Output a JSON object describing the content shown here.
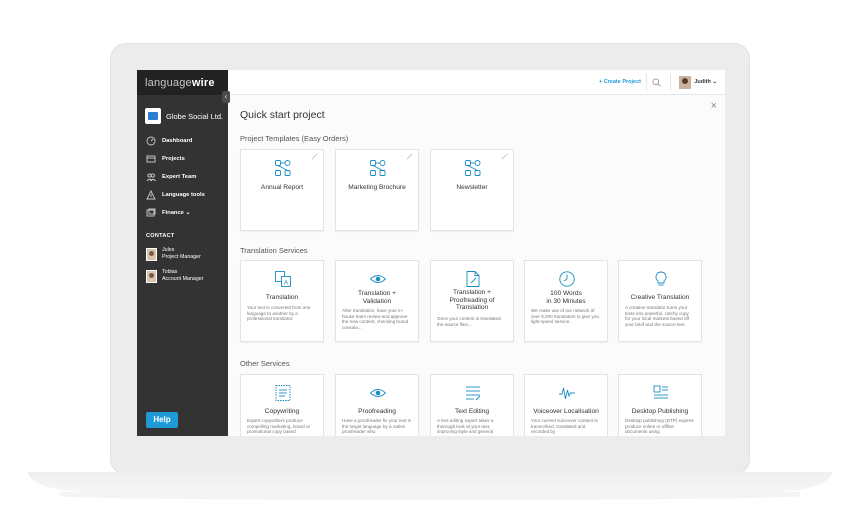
{
  "app": {
    "logo_light": "language",
    "logo_bold": "wire",
    "company": "Globe Social Ltd."
  },
  "sidebar": {
    "collapse_glyph": "‹",
    "items": [
      {
        "label": "Dashboard",
        "icon": "dashboard-icon"
      },
      {
        "label": "Projects",
        "icon": "projects-icon"
      },
      {
        "label": "Expert Team",
        "icon": "expert-team-icon"
      },
      {
        "label": "Language tools",
        "icon": "language-tools-icon"
      },
      {
        "label": "Finance ⌄",
        "icon": "finance-icon"
      }
    ],
    "contact_heading": "CONTACT",
    "contacts": [
      {
        "name": "Jules",
        "role": "Project Manager"
      },
      {
        "name": "Tobias",
        "role": "Account Manager"
      }
    ],
    "help_label": "Help"
  },
  "topbar": {
    "create_label": "+ Create Project",
    "user_name": "Judith ⌄"
  },
  "main": {
    "close_glyph": "×",
    "title": "Quick start project",
    "sections": {
      "templates": "Project Templates (Easy Orders)",
      "translation": "Translation Services",
      "other": "Other Services"
    },
    "templates": [
      {
        "title": "Annual Report"
      },
      {
        "title": "Marketing Brochure"
      },
      {
        "title": "Newsletter"
      }
    ],
    "translation_services": [
      {
        "title": "Translation",
        "desc": "Your text is converted from one language to another by a professional translator."
      },
      {
        "title": "Translation +\nValidation",
        "desc": "After translation, have your in-house team review and approve the new content, checking brand consola..."
      },
      {
        "title": "Translation +\nProofreading of\nTranslation",
        "desc": "Once your content is translated, the source files..."
      },
      {
        "title": "100 Words\nin 30 Minutes",
        "desc": "We make use of our network of over 5,000 translators to give you light-speed service."
      },
      {
        "title": "Creative Translation",
        "desc": "A creative translator turns your texts into powerful, catchy copy for your local markets based off your brief and the source text."
      }
    ],
    "other_services": [
      {
        "title": "Copywriting",
        "desc": "Expert copywriters produce compelling marketing, brand or promotional copy based"
      },
      {
        "title": "Proofreading",
        "desc": "Have a proofreader fix your text in the target language by a native proofreader who"
      },
      {
        "title": "Text Editing",
        "desc": "A text editing expert takes a thorough look at your text, improving style and general"
      },
      {
        "title": "Voiceover Localisation",
        "desc": "Your current voiceover content is transcribed, translated and recorded by"
      },
      {
        "title": "Desktop Publishing",
        "desc": "Desktop publishing (DTP) experts produce online or offline documents using"
      }
    ]
  },
  "colors": {
    "accent": "#1e9ad6",
    "sidebar": "#333333",
    "icon_stroke": "#1a8dc4"
  }
}
